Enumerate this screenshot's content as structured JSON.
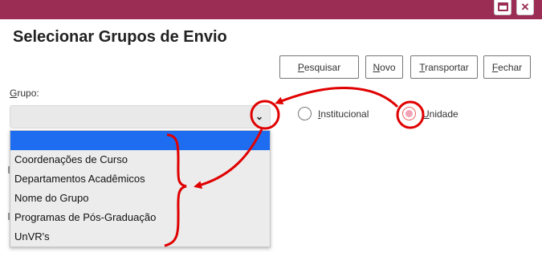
{
  "window": {
    "restore_icon": "restore-window-icon",
    "close_icon": "close-icon",
    "close_glyph": "×",
    "accent_color": "#9b2d55"
  },
  "page": {
    "title": "Selecionar Grupos de Envio"
  },
  "toolbar": {
    "pesquisar": {
      "key": "P",
      "rest": "esquisar"
    },
    "novo": {
      "key": "N",
      "rest": "ovo"
    },
    "transportar": {
      "key": "T",
      "rest": "ransportar"
    },
    "fechar": {
      "key": "F",
      "rest": "echar"
    }
  },
  "grupo": {
    "label_key": "G",
    "label_rest": "rupo:",
    "selected_value": "",
    "chevron": "⌄",
    "options": [
      "",
      "Coordenações de Curso",
      "Departamentos Acadêmicos",
      "Nome do Grupo",
      "Programas de Pós-Graduação",
      "UnVR's"
    ]
  },
  "tipo": {
    "institucional": {
      "key": "I",
      "rest": "nstitucional",
      "checked": false
    },
    "unidade": {
      "key": "U",
      "rest": "nidade",
      "checked": true
    }
  },
  "annotation_color": "#e00000"
}
